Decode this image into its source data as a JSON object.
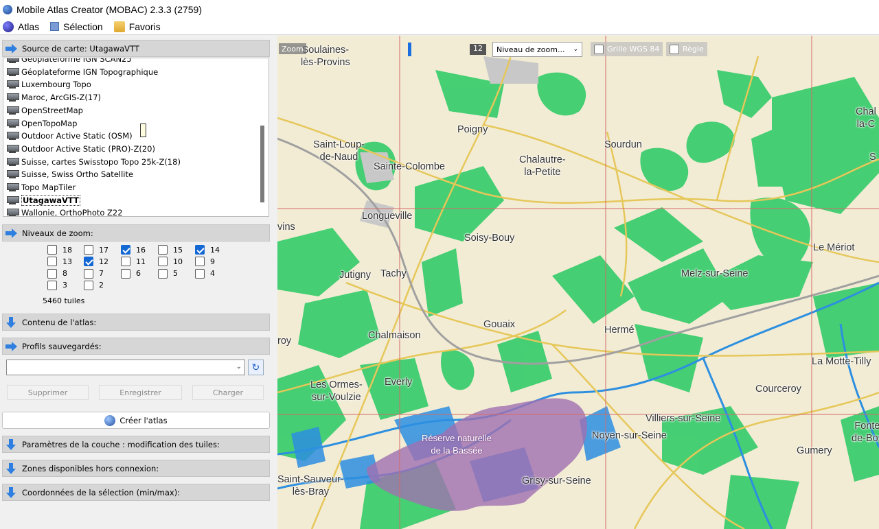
{
  "window": {
    "title": "Mobile Atlas Creator (MOBAC) 2.3.3 (2759)"
  },
  "menu": {
    "atlas": "Atlas",
    "selection": "Sélection",
    "favoris": "Favoris"
  },
  "map_source": {
    "header": "Source de carte: UtagawaVTT",
    "items": [
      "Géoplateforme IGN SCAN25",
      "Géoplateforme IGN Topographique",
      "Luxembourg Topo",
      "Maroc, ArcGIS-Z(17)",
      "OpenStreetMap",
      "OpenTopoMap",
      "Outdoor Active Static (OSM)",
      "Outdoor Active Static (PRO)-Z(20)",
      "Suisse, cartes Swisstopo Topo 25k-Z(18)",
      "Suisse, Swiss  Ortho Satellite",
      "Topo MapTiler",
      "UtagawaVTT",
      "Wallonie, OrthoPhoto Z22"
    ],
    "selected": "UtagawaVTT"
  },
  "zoom_levels": {
    "header": "Niveaux de zoom:",
    "levels": [
      {
        "label": "18",
        "checked": false
      },
      {
        "label": "17",
        "checked": false
      },
      {
        "label": "16",
        "checked": true
      },
      {
        "label": "15",
        "checked": false
      },
      {
        "label": "14",
        "checked": true
      },
      {
        "label": "13",
        "checked": false
      },
      {
        "label": "12",
        "checked": true
      },
      {
        "label": "11",
        "checked": false
      },
      {
        "label": "10",
        "checked": false
      },
      {
        "label": "9",
        "checked": false
      },
      {
        "label": "8",
        "checked": false
      },
      {
        "label": "7",
        "checked": false
      },
      {
        "label": "6",
        "checked": false
      },
      {
        "label": "5",
        "checked": false
      },
      {
        "label": "4",
        "checked": false
      },
      {
        "label": "3",
        "checked": false
      },
      {
        "label": "2",
        "checked": false
      }
    ],
    "tiles": "5460 tuiles"
  },
  "atlas_content": {
    "header": "Contenu de l'atlas:"
  },
  "profiles": {
    "header": "Profils sauvegardés:",
    "value": "",
    "delete": "Supprimer",
    "save": "Enregistrer",
    "load": "Charger"
  },
  "create_atlas": "Créer l'atlas",
  "collapsed_sections": {
    "layer_params": "Paramètres de la couche : modification des tuiles:",
    "offline_zones": "Zones disponibles hors connexion:",
    "coords": "Coordonnées de la sélection (min/max):"
  },
  "map_controls": {
    "zoom_label": "Zoom",
    "zoom_value": "12",
    "zoom_level": 12,
    "zoom_select": "Niveau de zoom...",
    "grid_label": "Grille WGS 84",
    "ruler_label": "Règle"
  },
  "places": [
    "Soulaines-\nlès-Provins",
    "Provins",
    "Poigny",
    "Saint-Loup-\nde-Naud",
    "Sainte-Colombe",
    "Chalautre-\nla-Petite",
    "Sourdun",
    "Longueville",
    "Soisy-Bouy",
    "Le Mériot",
    "Melz-sur-Seine",
    "Jutigny",
    "Tachy",
    "Gouaix",
    "Chalmaison",
    "Hermé",
    "La Motte-Tilly",
    "Les Ormes-\nsur-Voulzie",
    "Everly",
    "Courceroy",
    "Villiers-sur-Seine",
    "Noyen-sur-Seine",
    "Réserve naturelle\nde la Bassée",
    "Gumery",
    "Fonte\nde-Bos",
    "Saint-Sauveur-\nlès-Bray",
    "Grisy-sur-Seine",
    "vins",
    "roy",
    "Chal\nla-C",
    "S"
  ],
  "colors": {
    "forest": "#2fc864",
    "water": "#2d8fe0",
    "reserve": "#a070b0",
    "grid": "#d06060",
    "road": "#e8c860"
  }
}
